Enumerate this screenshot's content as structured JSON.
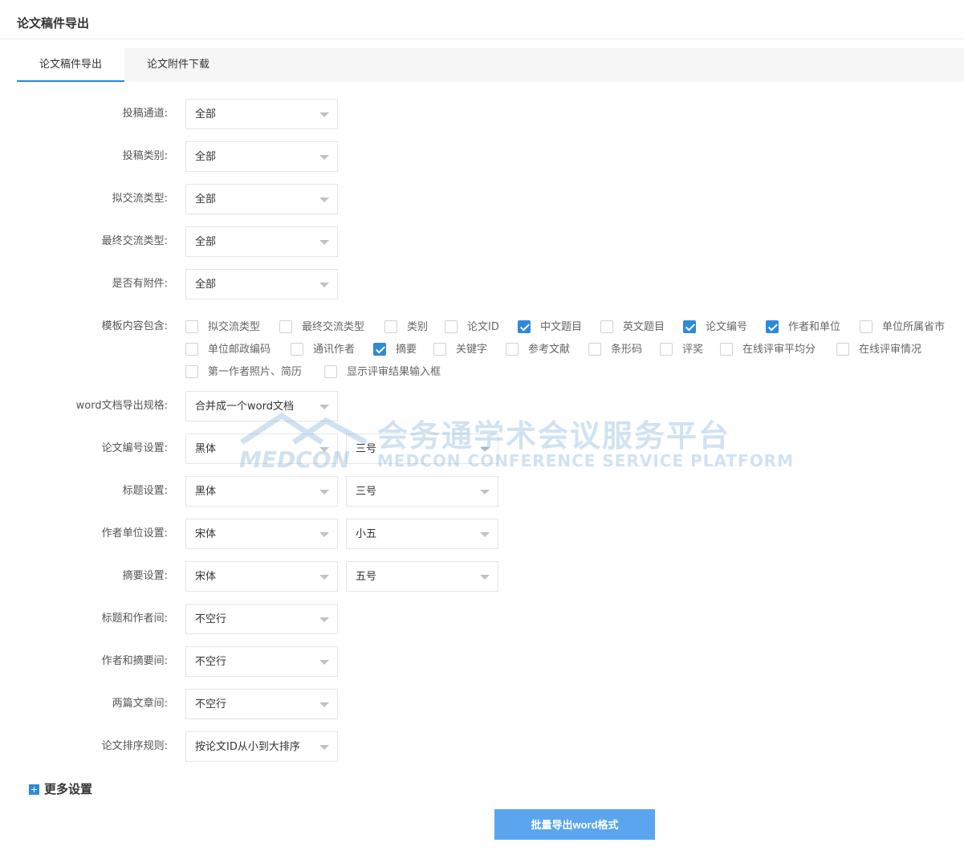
{
  "page_title": "论文稿件导出",
  "tabs": [
    {
      "label": "论文稿件导出",
      "active": true
    },
    {
      "label": "论文附件下载",
      "active": false
    }
  ],
  "form": {
    "channel": {
      "label": "投稿通道:",
      "value": "全部"
    },
    "category": {
      "label": "投稿类别:",
      "value": "全部"
    },
    "proposed_type": {
      "label": "拟交流类型:",
      "value": "全部"
    },
    "final_type": {
      "label": "最终交流类型:",
      "value": "全部"
    },
    "has_attachment": {
      "label": "是否有附件:",
      "value": "全部"
    },
    "template": {
      "label": "模板内容包含:",
      "options": [
        {
          "label": "拟交流类型",
          "checked": false
        },
        {
          "label": "最终交流类型",
          "checked": false
        },
        {
          "label": "类别",
          "checked": false
        },
        {
          "label": "论文ID",
          "checked": false
        },
        {
          "label": "中文题目",
          "checked": true
        },
        {
          "label": "英文题目",
          "checked": false
        },
        {
          "label": "论文编号",
          "checked": true
        },
        {
          "label": "作者和单位",
          "checked": true
        },
        {
          "label": "单位所属省市",
          "checked": false
        },
        {
          "label": "单位邮政编码",
          "checked": false
        },
        {
          "label": "通讯作者",
          "checked": false
        },
        {
          "label": "摘要",
          "checked": true
        },
        {
          "label": "关键字",
          "checked": false
        },
        {
          "label": "参考文献",
          "checked": false
        },
        {
          "label": "条形码",
          "checked": false
        },
        {
          "label": "评奖",
          "checked": false
        },
        {
          "label": "在线评审平均分",
          "checked": false
        },
        {
          "label": "在线评审情况",
          "checked": false
        },
        {
          "label": "第一作者照片、简历",
          "checked": false
        },
        {
          "label": "显示评审结果输入框",
          "checked": false
        }
      ]
    },
    "word_spec": {
      "label": "word文档导出规格:",
      "value": "合并成一个word文档"
    },
    "number_setting": {
      "label": "论文编号设置:",
      "font": "黑体",
      "size": "三号"
    },
    "title_setting": {
      "label": "标题设置:",
      "font": "黑体",
      "size": "三号"
    },
    "author_setting": {
      "label": "作者单位设置:",
      "font": "宋体",
      "size": "小五"
    },
    "abstract_setting": {
      "label": "摘要设置:",
      "font": "宋体",
      "size": "五号"
    },
    "title_author_gap": {
      "label": "标题和作者间:",
      "value": "不空行"
    },
    "author_abstract_gap": {
      "label": "作者和摘要间:",
      "value": "不空行"
    },
    "article_gap": {
      "label": "两篇文章间:",
      "value": "不空行"
    },
    "sort_rule": {
      "label": "论文排序规则:",
      "value": "按论文ID从小到大排序"
    }
  },
  "more_settings": "更多设置",
  "export_button": "批量导出word格式",
  "watermark": {
    "cn": "会务通学术会议服务平台",
    "en": "MEDCON CONFERENCE SERVICE PLATFORM",
    "brand": "MEDCON"
  },
  "colors": {
    "accent": "#2f8ad8",
    "tab_underline": "#1a8fd9",
    "button": "#5aa5ee",
    "checkbox_checked": "#2f8ad8"
  }
}
